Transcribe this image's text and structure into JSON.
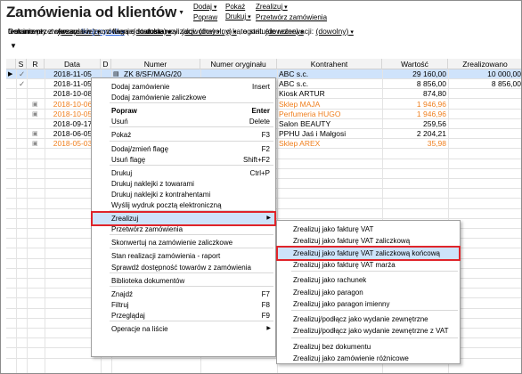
{
  "title": "Zamówienia od klientów",
  "toolbar": [
    {
      "items": [
        "Dodaj",
        "Popraw"
      ]
    },
    {
      "items": [
        "Pokaż",
        "Drukuj"
      ]
    },
    {
      "items": [
        "Zrealizuj",
        "Przetwórz zamówienia"
      ]
    }
  ],
  "filters": {
    "okres_label": "Dokumenty z okresu:",
    "okres_value": "bieżący rok",
    "realizacja_label": ", o statusie realizacji:",
    "realizacja_value": "(dowolny)",
    "rezerwacja_label": ", o statusie rezerwacji:",
    "rezerwacja_value": "(dowolny)",
    "przetwarzanie_label": "o stanie przetwarzania w zamówienie do dostawcy:",
    "przetwarzanie_value": "(dowolne)",
    "kategoria_label": ", o kategorii:",
    "kategoria_value": "(dowolne)",
    "terminowe_label": "terminowe:",
    "terminowe_value": "(wszystkie)",
    "flaga_label": ", z flagą:",
    "flaga_value": "(dowolna)"
  },
  "columns": [
    "S",
    "R",
    "Data",
    "D",
    "Numer",
    "Numer oryginału",
    "Kontrahent",
    "Wartość",
    "Zrealizowano"
  ],
  "rows": [
    {
      "data": "2018-11-05",
      "numer": "ZK 8/SF/MAG/20",
      "kontrahent": "ABC s.c.",
      "wartosc": "29 160,00",
      "zrealizowano": "10 000,00",
      "orange": false,
      "lock": false
    },
    {
      "data": "2018-11-05",
      "numer": "",
      "kontrahent": "ABC s.c.",
      "wartosc": "8 856,00",
      "zrealizowano": "8 856,00",
      "orange": false,
      "lock": false
    },
    {
      "data": "2018-10-08",
      "numer": "",
      "kontrahent": "Kiosk ARTUR",
      "wartosc": "874,80",
      "zrealizowano": "",
      "orange": false,
      "lock": false
    },
    {
      "data": "2018-10-06",
      "numer": "",
      "kontrahent": "Sklep MAJA",
      "wartosc": "1 946,96",
      "zrealizowano": "",
      "orange": true,
      "lock": true
    },
    {
      "data": "2018-10-05",
      "numer": "",
      "kontrahent": "Perfumeria HUGO",
      "wartosc": "1 946,96",
      "zrealizowano": "",
      "orange": true,
      "lock": true
    },
    {
      "data": "2018-09-17",
      "numer": "",
      "kontrahent": "Salon BEAUTY",
      "wartosc": "259,56",
      "zrealizowano": "",
      "orange": false,
      "lock": false
    },
    {
      "data": "2018-06-05",
      "numer": "",
      "kontrahent": "PPHU Jaś i Małgosi",
      "wartosc": "2 204,21",
      "zrealizowano": "",
      "orange": false,
      "lock": true
    },
    {
      "data": "2018-05-03",
      "numer": "",
      "kontrahent": "Sklep AREX",
      "wartosc": "35,98",
      "zrealizowano": "",
      "orange": true,
      "lock": true
    }
  ],
  "context_menu": [
    {
      "label": "Dodaj zamówienie",
      "shortcut": "Insert"
    },
    {
      "label": "Dodaj zamówienie zaliczkowe",
      "shortcut": ""
    },
    {
      "sep": true
    },
    {
      "label": "Popraw",
      "shortcut": "Enter",
      "bold": true
    },
    {
      "label": "Usuń",
      "shortcut": "Delete"
    },
    {
      "sep": true
    },
    {
      "label": "Pokaż",
      "shortcut": "F3"
    },
    {
      "sep": true
    },
    {
      "label": "Dodaj/zmień flagę",
      "shortcut": "F2"
    },
    {
      "label": "Usuń flagę",
      "shortcut": "Shift+F2"
    },
    {
      "sep": true
    },
    {
      "label": "Drukuj",
      "shortcut": "Ctrl+P"
    },
    {
      "label": "Drukuj naklejki z towarami",
      "shortcut": ""
    },
    {
      "label": "Drukuj naklejki z kontrahentami",
      "shortcut": ""
    },
    {
      "label": "Wyślij wydruk pocztą elektroniczną",
      "shortcut": ""
    },
    {
      "sep": true
    },
    {
      "label": "Zrealizuj",
      "shortcut": "",
      "submenu": true,
      "highlight": true
    },
    {
      "label": "Przetwórz zamówienia",
      "shortcut": ""
    },
    {
      "sep": true
    },
    {
      "label": "Skonwertuj na zamówienie zaliczkowe",
      "shortcut": ""
    },
    {
      "sep": true
    },
    {
      "label": "Stan realizacji zamówienia - raport",
      "shortcut": ""
    },
    {
      "label": "Sprawdź dostępność towarów z zamówienia",
      "shortcut": ""
    },
    {
      "sep": true
    },
    {
      "label": "Biblioteka dokumentów",
      "shortcut": ""
    },
    {
      "sep": true
    },
    {
      "label": "Znajdź",
      "shortcut": "F7"
    },
    {
      "label": "Filtruj",
      "shortcut": "F8"
    },
    {
      "label": "Przeglądaj",
      "shortcut": "F9"
    },
    {
      "sep": true
    },
    {
      "label": "Operacje na liście",
      "shortcut": "",
      "submenu": true
    }
  ],
  "submenu": [
    {
      "label": "Zrealizuj jako fakturę VAT"
    },
    {
      "label": "Zrealizuj jako fakturę VAT zaliczkową"
    },
    {
      "label": "Zrealizuj jako fakturę VAT zaliczkową końcową",
      "highlight": true
    },
    {
      "label": "Zrealizuj jako fakturę VAT marża"
    },
    {
      "sep": true
    },
    {
      "label": "Zrealizuj jako rachunek"
    },
    {
      "label": "Zrealizuj jako paragon"
    },
    {
      "label": "Zrealizuj jako paragon imienny"
    },
    {
      "sep": true
    },
    {
      "label": "Zrealizuj/podłącz jako wydanie zewnętrzne"
    },
    {
      "label": "Zrealizuj/podłącz jako wydanie zewnętrzne z VAT"
    },
    {
      "sep": true
    },
    {
      "label": "Zrealizuj bez dokumentu"
    },
    {
      "label": "Zrealizuj jako zamówienie różnicowe"
    }
  ]
}
